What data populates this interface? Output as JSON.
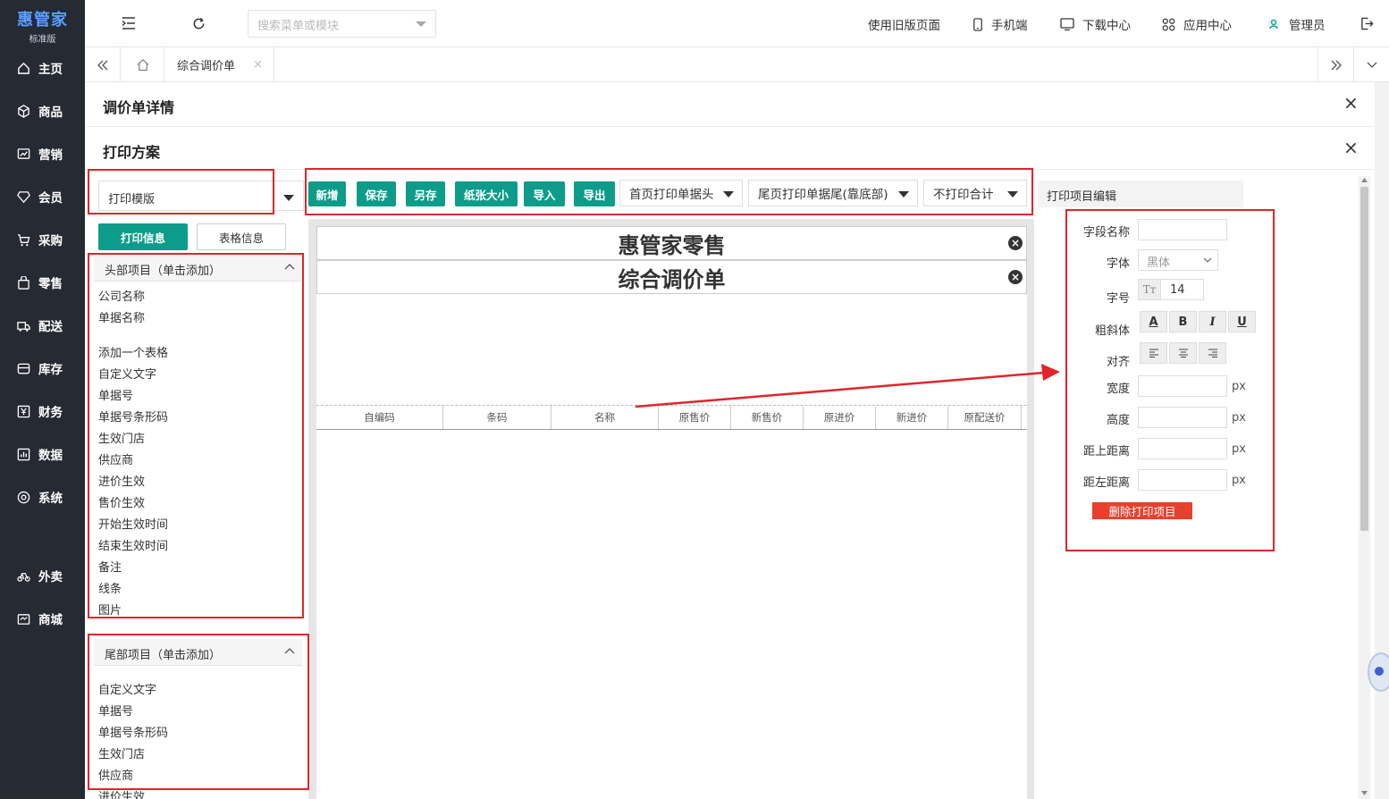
{
  "app": {
    "logo": "惠管家",
    "edition": "标准版"
  },
  "sidebar": {
    "items": [
      {
        "label": "主页",
        "icon": "home-icon"
      },
      {
        "label": "商品",
        "icon": "cube-icon"
      },
      {
        "label": "营销",
        "icon": "chart-icon"
      },
      {
        "label": "会员",
        "icon": "diamond-icon"
      },
      {
        "label": "采购",
        "icon": "cart-icon"
      },
      {
        "label": "零售",
        "icon": "bag-icon"
      },
      {
        "label": "配送",
        "icon": "truck-icon"
      },
      {
        "label": "库存",
        "icon": "warehouse-icon"
      },
      {
        "label": "财务",
        "icon": "yen-icon"
      },
      {
        "label": "数据",
        "icon": "bar-chart-icon"
      },
      {
        "label": "系统",
        "icon": "settings-icon"
      },
      {
        "label": "外卖",
        "icon": "bike-icon"
      },
      {
        "label": "商城",
        "icon": "shop-icon"
      }
    ]
  },
  "topbar": {
    "search_placeholder": "搜索菜单或模块",
    "links": [
      "使用旧版页面",
      "手机端",
      "下载中心",
      "应用中心",
      "管理员"
    ]
  },
  "tabs": {
    "active": "综合调价单"
  },
  "main": {
    "detail_title": "调价单详情",
    "print_title": "打印方案",
    "template_select": "打印模版",
    "btn_print_info": "打印信息",
    "btn_table_info": "表格信息",
    "toolbar": {
      "buttons": [
        "新增",
        "保存",
        "另存",
        "纸张大小",
        "导入",
        "导出"
      ],
      "dropdowns": [
        "首页打印单据头",
        "尾页打印单据尾(靠底部)",
        "不打印合计"
      ]
    },
    "header_panel": {
      "title": "头部项目（单击添加）",
      "items": [
        "公司名称",
        "单据名称",
        "添加一个表格",
        "自定义文字",
        "单据号",
        "单据号条形码",
        "生效门店",
        "供应商",
        "进价生效",
        "售价生效",
        "开始生效时间",
        "结束生效时间",
        "备注",
        "线条",
        "图片"
      ]
    },
    "footer_panel": {
      "title": "尾部项目（单击添加）",
      "items": [
        "自定义文字",
        "单据号",
        "单据号条形码",
        "生效门店",
        "供应商",
        "进价生效"
      ]
    },
    "preview": {
      "company": "惠管家零售",
      "doc_name": "综合调价单",
      "columns": [
        "自编码",
        "条码",
        "名称",
        "原售价",
        "新售价",
        "原进价",
        "新进价",
        "原配送价"
      ]
    },
    "editor": {
      "title": "打印项目编辑",
      "field_name_label": "字段名称",
      "font_label": "字体",
      "font_value": "黑体",
      "size_label": "字号",
      "size_value": "14",
      "style_label": "粗斜体",
      "style_buttons": [
        "A",
        "B",
        "I",
        "U"
      ],
      "align_label": "对齐",
      "width_label": "宽度",
      "height_label": "高度",
      "top_label": "距上距离",
      "left_label": "距左距离",
      "unit": "px",
      "delete_btn": "删除打印项目"
    }
  }
}
